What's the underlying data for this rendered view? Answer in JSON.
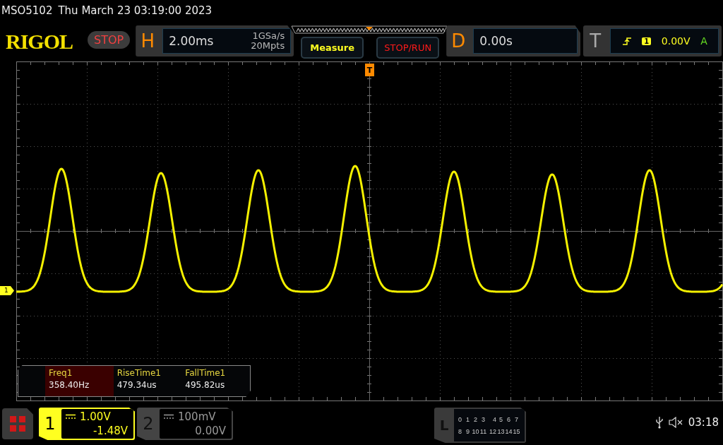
{
  "status_line": {
    "model": "MSO5102",
    "datetime": "Thu March 23 03:19:00 2023"
  },
  "toolbar": {
    "logo": "RIGOL",
    "run_state": "STOP",
    "horizontal": {
      "label": "H",
      "timebase": "2.00ms",
      "sample_rate": "1GSa/s",
      "memory_depth": "20Mpts"
    },
    "buttons": [
      {
        "label": "Measure",
        "kind": "measure"
      },
      {
        "label": "STOP/RUN",
        "kind": "stoprun"
      }
    ],
    "delay": {
      "label": "D",
      "value": "0.00s"
    },
    "trigger": {
      "label": "T",
      "source": "1",
      "level": "0.00V",
      "mode": "A"
    }
  },
  "screen": {
    "trigger_marker": "T",
    "channel_marker": "1"
  },
  "measurements": [
    {
      "name": "Freq1",
      "value": "358.40Hz",
      "selected": true
    },
    {
      "name": "RiseTime1",
      "value": "479.34us",
      "selected": false
    },
    {
      "name": "FallTime1",
      "value": "495.82us",
      "selected": false
    }
  ],
  "channels": [
    {
      "number": "1",
      "scale": "1.00V",
      "offset": "-1.48V",
      "active": true
    },
    {
      "number": "2",
      "scale": "100mV",
      "offset": "0.00V",
      "active": false
    }
  ],
  "logic": {
    "label": "L",
    "rows": [
      [
        "0",
        "1",
        "2",
        "3",
        "4",
        "5",
        "6",
        "7"
      ],
      [
        "8",
        "9",
        "10",
        "11",
        "12",
        "13",
        "14",
        "15"
      ]
    ]
  },
  "status": {
    "time": "03:18"
  }
}
